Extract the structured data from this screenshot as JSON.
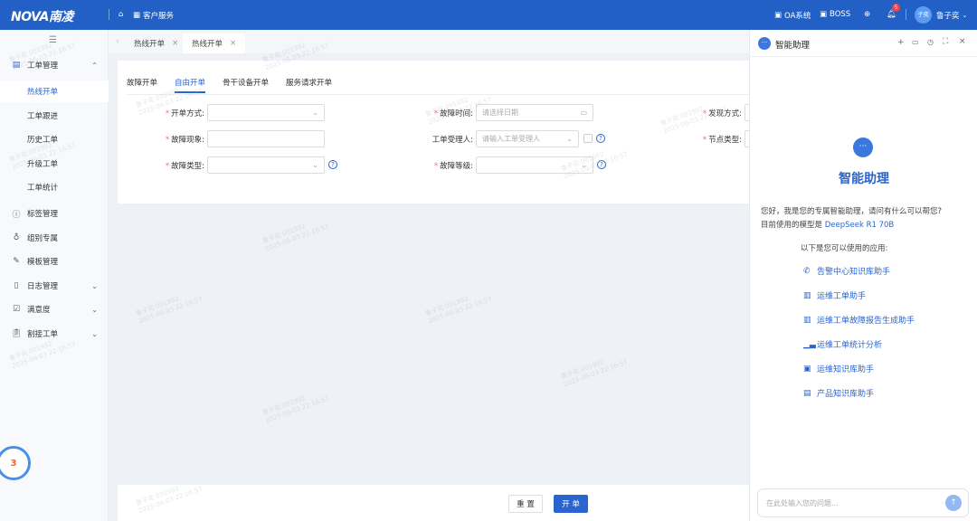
{
  "header": {
    "logo": "NOVA南凌",
    "app_menu": "客户服务",
    "links": [
      {
        "label": "OA系统"
      },
      {
        "label": "BOSS"
      }
    ],
    "notification_count": "5",
    "avatar_text": "子奕",
    "user_name": "鲁子奕"
  },
  "sidebar": {
    "items": [
      {
        "label": "工单管理",
        "icon": "ticket-icon",
        "expanded": true
      },
      {
        "label": "热线开单",
        "sub": true,
        "active": true
      },
      {
        "label": "工单跟进",
        "sub": true
      },
      {
        "label": "历史工单",
        "sub": true
      },
      {
        "label": "升级工单",
        "sub": true
      },
      {
        "label": "工单统计",
        "sub": true
      },
      {
        "label": "标签管理",
        "icon": "info-icon"
      },
      {
        "label": "组别专属",
        "icon": "award-icon"
      },
      {
        "label": "模板管理",
        "icon": "template-icon"
      },
      {
        "label": "日志管理",
        "icon": "file-icon",
        "chevron": true
      },
      {
        "label": "满意度",
        "icon": "checkbox-icon",
        "chevron": true
      },
      {
        "label": "割接工单",
        "icon": "clipboard-icon",
        "chevron": true
      }
    ],
    "float_badge": "3"
  },
  "tabs": [
    {
      "label": "热线开单"
    },
    {
      "label": "热线开单"
    }
  ],
  "form": {
    "tabs": [
      "故障开单",
      "自由开单",
      "骨干设备开单",
      "服务请求开单"
    ],
    "active_tab": "自由开单",
    "fields": {
      "open_method": {
        "label": "开单方式:",
        "value": ""
      },
      "fault_time": {
        "label": "故障时间:",
        "placeholder": "请选择日期"
      },
      "discover_method": {
        "label": "发现方式:"
      },
      "fault_symptom": {
        "label": "故障现象:",
        "value": ""
      },
      "assignee": {
        "label": "工单受理人:",
        "placeholder": "请输入工单受理人"
      },
      "node_type": {
        "label": "节点类型:"
      },
      "fault_type": {
        "label": "故障类型:",
        "value": ""
      },
      "fault_level": {
        "label": "故障等级:",
        "value": ""
      }
    },
    "reset_label": "重 置",
    "submit_label": "开 单"
  },
  "assistant": {
    "title": "智能助理",
    "hero_title": "智能助理",
    "greeting": "您好，我是您的专属智能助理，请问有什么可以帮您?",
    "model_prefix": "目前使用的模型是 ",
    "model_name": "DeepSeek R1 70B",
    "apps_heading": "以下是您可以使用的应用:",
    "apps": [
      {
        "label": "告警中心知识库助手",
        "icon": "whatsapp-icon"
      },
      {
        "label": "运维工单助手",
        "icon": "building-icon"
      },
      {
        "label": "运维工单故障报告生成助手",
        "icon": "building-icon"
      },
      {
        "label": "运维工单统计分析",
        "icon": "bar-chart-icon"
      },
      {
        "label": "运维知识库助手",
        "icon": "book-square-icon"
      },
      {
        "label": "产品知识库助手",
        "icon": "book-open-icon"
      }
    ],
    "input_placeholder": "在此处输入您的问题..."
  },
  "watermark": "鲁子奕 001992\n2025-06-03 22:16:57",
  "colors": {
    "brand": "#2360c6",
    "accent": "#2a64d0",
    "required": "#e57373"
  }
}
